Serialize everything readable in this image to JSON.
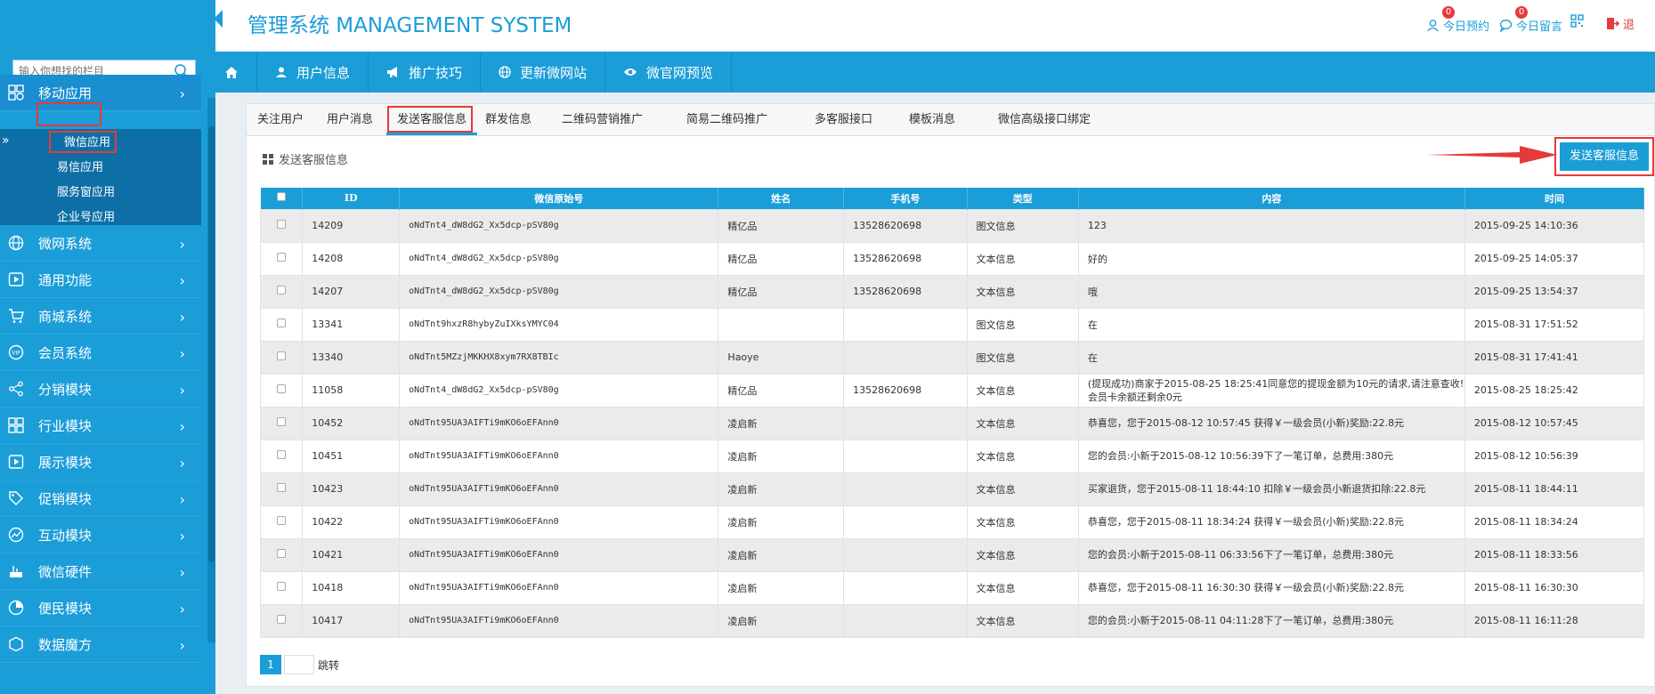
{
  "header": {
    "title": "管理系统 MANAGEMENT SYSTEM",
    "links": [
      {
        "label": "今日预约",
        "count": "0"
      },
      {
        "label": "今日留言",
        "count": "0"
      },
      {
        "label": "退"
      }
    ]
  },
  "sidebar": {
    "search_placeholder": "输入你想找的栏目",
    "items": [
      {
        "label": "移动应用",
        "icon": "apps-grid-icon"
      },
      {
        "label": "微网系统",
        "icon": "globe-icon"
      },
      {
        "label": "通用功能",
        "icon": "play-icon"
      },
      {
        "label": "商城系统",
        "icon": "cart-icon"
      },
      {
        "label": "会员系统",
        "icon": "vip-icon"
      },
      {
        "label": "分销模块",
        "icon": "share-icon"
      },
      {
        "label": "行业模块",
        "icon": "grid-icon"
      },
      {
        "label": "展示模块",
        "icon": "play-icon"
      },
      {
        "label": "促销模块",
        "icon": "tag-icon"
      },
      {
        "label": "互动模块",
        "icon": "chart-icon"
      },
      {
        "label": "微信硬件",
        "icon": "device-icon"
      },
      {
        "label": "便民模块",
        "icon": "pie-icon"
      },
      {
        "label": "数据魔方",
        "icon": "cube-icon"
      }
    ],
    "sub_items": [
      "微信应用",
      "易信应用",
      "服务窗应用",
      "企业号应用"
    ]
  },
  "topnav": {
    "items": [
      "用户信息",
      "推广技巧",
      "更新微网站",
      "微官网预览"
    ]
  },
  "tabs": [
    "关注用户",
    "用户消息",
    "发送客服信息",
    "群发信息",
    "二维码营销推广",
    "简易二维码推广",
    "多客服接口",
    "模板消息",
    "微信高级接口绑定"
  ],
  "section_title": "发送客服信息",
  "send_button": "发送客服信息",
  "table": {
    "headers": [
      "ID",
      "微信原始号",
      "姓名",
      "手机号",
      "类型",
      "内容",
      "时间"
    ],
    "rows": [
      [
        "14209",
        "oNdTnt4_dW8dG2_Xx5dcp-pSV80g",
        "精亿品",
        "13528620698",
        "图文信息",
        "123",
        "2015-09-25 14:10:36"
      ],
      [
        "14208",
        "oNdTnt4_dW8dG2_Xx5dcp-pSV80g",
        "精亿品",
        "13528620698",
        "文本信息",
        "好的",
        "2015-09-25 14:05:37"
      ],
      [
        "14207",
        "oNdTnt4_dW8dG2_Xx5dcp-pSV80g",
        "精亿品",
        "13528620698",
        "文本信息",
        "哦",
        "2015-09-25 13:54:37"
      ],
      [
        "13341",
        "oNdTnt9hxzR8hybyZuIXksYMYC04",
        "",
        "",
        "图文信息",
        "在",
        "2015-08-31 17:51:52"
      ],
      [
        "13340",
        "oNdTnt5MZzjMKKHX8xym7RX8TBIc",
        "Haoye",
        "",
        "图文信息",
        "在",
        "2015-08-31 17:41:41"
      ],
      [
        "11058",
        "oNdTnt4_dW8dG2_Xx5dcp-pSV80g",
        "精亿品",
        "13528620698",
        "文本信息",
        "(提现成功)商家于2015-08-25 18:25:41同意您的提现金额为10元的请求,请注意查收! 会员卡余额还剩余0元",
        "2015-08-25 18:25:42"
      ],
      [
        "10452",
        "oNdTnt95UA3AIFTi9mKO6oEFAnn0",
        "凌启新",
        "",
        "文本信息",
        "恭喜您，您于2015-08-12 10:57:45 获得￥一级会员(小新)奖励:22.8元",
        "2015-08-12 10:57:45"
      ],
      [
        "10451",
        "oNdTnt95UA3AIFTi9mKO6oEFAnn0",
        "凌启新",
        "",
        "文本信息",
        "您的会员:小新于2015-08-12 10:56:39下了一笔订单，总费用:380元",
        "2015-08-12 10:56:39"
      ],
      [
        "10423",
        "oNdTnt95UA3AIFTi9mKO6oEFAnn0",
        "凌启新",
        "",
        "文本信息",
        "买家退货，您于2015-08-11 18:44:10 扣除￥一级会员小新退货扣除:22.8元",
        "2015-08-11 18:44:11"
      ],
      [
        "10422",
        "oNdTnt95UA3AIFTi9mKO6oEFAnn0",
        "凌启新",
        "",
        "文本信息",
        "恭喜您，您于2015-08-11 18:34:24 获得￥一级会员(小新)奖励:22.8元",
        "2015-08-11 18:34:24"
      ],
      [
        "10421",
        "oNdTnt95UA3AIFTi9mKO6oEFAnn0",
        "凌启新",
        "",
        "文本信息",
        "您的会员:小新于2015-08-11 06:33:56下了一笔订单，总费用:380元",
        "2015-08-11 18:33:56"
      ],
      [
        "10418",
        "oNdTnt95UA3AIFTi9mKO6oEFAnn0",
        "凌启新",
        "",
        "文本信息",
        "恭喜您，您于2015-08-11 16:30:30 获得￥一级会员(小新)奖励:22.8元",
        "2015-08-11 16:30:30"
      ],
      [
        "10417",
        "oNdTnt95UA3AIFTi9mKO6oEFAnn0",
        "凌启新",
        "",
        "文本信息",
        "您的会员:小新于2015-08-11 04:11:28下了一笔订单，总费用:380元",
        "2015-08-11 16:11:28"
      ]
    ]
  },
  "pager": {
    "current": "1",
    "jump_label": "跳转"
  },
  "colors": {
    "primary": "#1b9dd8",
    "highlight": "#e53a3a"
  }
}
